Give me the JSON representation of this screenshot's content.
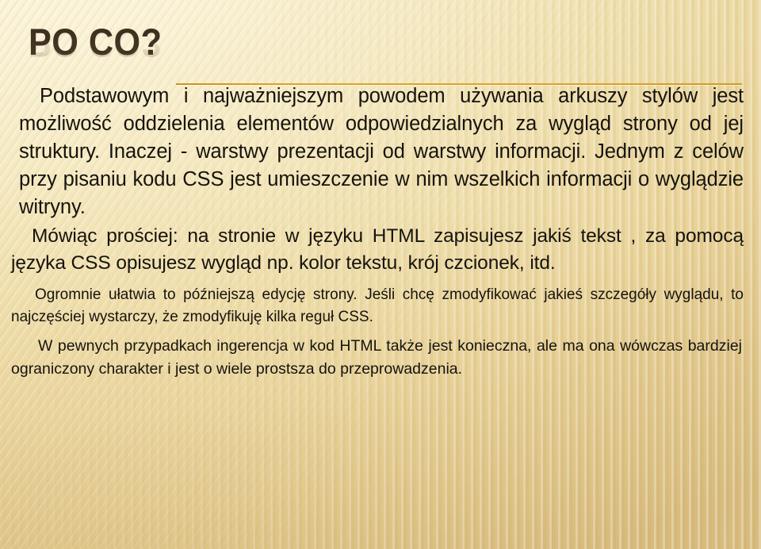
{
  "slide": {
    "title": "PO CO?",
    "background": {
      "color_top_left": "#faf3d8",
      "color_bottom_right": "#dcc184",
      "texture": "diagonal-and-vertical-stripes"
    },
    "divider": {
      "name": "title-rule",
      "color": "#d4a017"
    },
    "title_color": "#3e301f",
    "body_color": "#16130e",
    "paragraphs": [
      {
        "id": "para-1",
        "text": "Podstawowym i najważniejszym powodem używania arkuszy stylów  jest możliwość oddzielenia elementów odpowiedzialnych za wygląd strony od jej struktury. Inaczej - warstwy prezentacji od warstwy informacji. Jednym z  celów przy pisaniu kodu CSS  jest umieszczenie w nim wszelkich informacji o wyglądzie witryny."
      },
      {
        "id": "para-2",
        "text": "Mówiąc prościej: na  stronie w  języku HTML  zapisujesz  jakiś tekst , za  pomocą  języka CSS opisujesz  wygląd np. kolor tekstu, krój czcionek, itd."
      },
      {
        "id": "para-3",
        "text": "Ogromnie ułatwia  to późniejszą  edycję  strony.  Jeśli  chcę  zmodyfikować jakieś szczegóły  wyglądu,  to  najczęściej  wystarczy,  że  zmodyfikuję  kilka reguł  CSS."
      },
      {
        "id": "para-4",
        "text": "W pewnych przypadkach  ingerencja w kod HTML  także  jest  konieczna, ale  ma  ona wówczas bardziej ograniczony charakter i jest o wiele prostsza do przeprowadzenia."
      }
    ]
  }
}
